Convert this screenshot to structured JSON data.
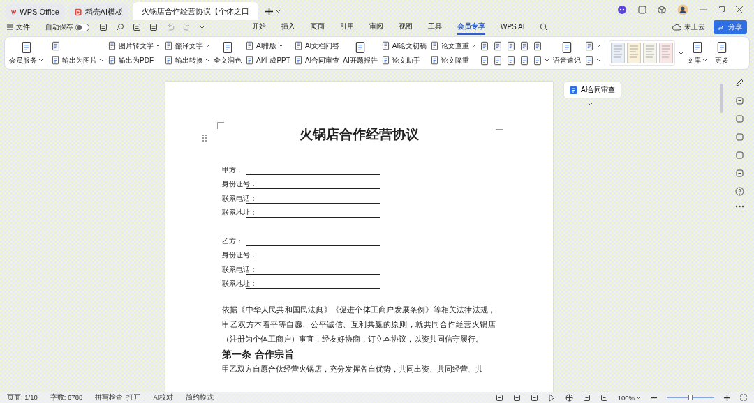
{
  "titlebar": {
    "tabs": [
      {
        "kind": "home",
        "label": "WPS Office",
        "selected": false
      },
      {
        "kind": "template",
        "label": "稻壳AI模板",
        "selected": false
      },
      {
        "kind": "doc",
        "label": "火锅店合作经营协议【个体之口",
        "selected": true
      }
    ]
  },
  "menubar": {
    "file": "文件",
    "autosave": {
      "label": "自动保存",
      "on": false
    },
    "tabs": [
      {
        "label": "开始",
        "selected": false
      },
      {
        "label": "插入",
        "selected": false
      },
      {
        "label": "页面",
        "selected": false
      },
      {
        "label": "引用",
        "selected": false
      },
      {
        "label": "审阅",
        "selected": false
      },
      {
        "label": "视图",
        "selected": false
      },
      {
        "label": "工具",
        "selected": false
      },
      {
        "label": "会员专享",
        "selected": true
      },
      {
        "label": "WPS AI",
        "selected": false
      }
    ],
    "cloud": "未上云",
    "share": "分享"
  },
  "ribbon": [
    {
      "kind": "big",
      "label": "会员服务",
      "caret": true
    },
    {
      "kind": "sep"
    },
    {
      "kind": "pair",
      "items": [
        {
          "kind": "icon",
          "caret": false
        },
        {
          "kind": "text",
          "label": "输出为图片",
          "caret": true
        }
      ]
    },
    {
      "kind": "pair",
      "items": [
        {
          "kind": "text",
          "label": "图片转文字",
          "caret": true
        },
        {
          "kind": "text",
          "label": "输出为PDF",
          "caret": false
        }
      ]
    },
    {
      "kind": "pair",
      "items": [
        {
          "kind": "text",
          "label": "翻译文字",
          "caret": true
        },
        {
          "kind": "text",
          "label": "输出转换",
          "caret": true
        }
      ]
    },
    {
      "kind": "big",
      "label": "全文润色",
      "caret": false
    },
    {
      "kind": "pair",
      "items": [
        {
          "kind": "text",
          "label": "AI排版",
          "caret": true
        },
        {
          "kind": "text",
          "label": "AI生成PPT",
          "caret": false
        }
      ]
    },
    {
      "kind": "pair",
      "items": [
        {
          "kind": "text",
          "label": "AI文档问答",
          "caret": false
        },
        {
          "kind": "text",
          "label": "AI合同审查",
          "caret": false
        }
      ]
    },
    {
      "kind": "big",
      "label": "AI开题报告",
      "caret": false
    },
    {
      "kind": "pair",
      "items": [
        {
          "kind": "text",
          "label": "AI论文初稿",
          "caret": false
        },
        {
          "kind": "text",
          "label": "论文助手",
          "caret": false
        }
      ]
    },
    {
      "kind": "pair",
      "items": [
        {
          "kind": "text",
          "label": "论文查重",
          "caret": true
        },
        {
          "kind": "text",
          "label": "论文降重",
          "caret": false
        }
      ]
    },
    {
      "kind": "pair",
      "items": [
        {
          "kind": "icon",
          "caret": false
        },
        {
          "kind": "icon",
          "caret": false
        }
      ]
    },
    {
      "kind": "pair",
      "items": [
        {
          "kind": "icon",
          "caret": false
        },
        {
          "kind": "icon",
          "caret": false
        }
      ]
    },
    {
      "kind": "pair",
      "items": [
        {
          "kind": "icon",
          "caret": false
        },
        {
          "kind": "icon",
          "caret": false
        }
      ]
    },
    {
      "kind": "pair",
      "items": [
        {
          "kind": "icon",
          "caret": false
        },
        {
          "kind": "icon",
          "caret": false
        }
      ]
    },
    {
      "kind": "pair",
      "items": [
        {
          "kind": "icon",
          "caret": false
        },
        {
          "kind": "icon",
          "caret": true
        }
      ]
    },
    {
      "kind": "big",
      "label": "语音速记",
      "caret": false
    },
    {
      "kind": "pair",
      "items": [
        {
          "kind": "icon",
          "caret": true
        },
        {
          "kind": "icon",
          "caret": true
        }
      ]
    },
    {
      "kind": "sep"
    },
    {
      "kind": "gallery"
    },
    {
      "kind": "big",
      "label": "文库",
      "caret": true
    },
    {
      "kind": "sep"
    },
    {
      "kind": "big",
      "label": "更多",
      "caret": false
    }
  ],
  "document": {
    "title": "火锅店合作经营协议",
    "parties": [
      {
        "fields": [
          {
            "label": "甲方：",
            "underline": true
          },
          {
            "label": "身份证号：",
            "underline": true
          },
          {
            "label": "联系电话：",
            "underline": true
          },
          {
            "label": "联系地址：",
            "underline": true
          }
        ]
      },
      {
        "fields": [
          {
            "label": "乙方：",
            "underline": true
          },
          {
            "label": "身份证号：",
            "underline": false
          },
          {
            "label": "联系电话：",
            "underline": true
          },
          {
            "label": "联系地址：",
            "underline": true
          }
        ]
      }
    ],
    "paragraphs": [
      {
        "kind": "body",
        "text": "依据《中华人民共和国民法典》《促进个体工商户发展条例》等相关法律法规，甲乙双方本着平等自愿、公平诚信、互利共赢的原则，就共同合作经营火锅店（注册为个体工商户）事宜，经友好协商，订立本协议，以资共同信守履行。"
      },
      {
        "kind": "heading",
        "text": "第一条  合作宗旨"
      },
      {
        "kind": "body",
        "text": "甲乙双方自愿合伙经营火锅店，充分发挥各自优势，共同出资、共同经营、共"
      }
    ]
  },
  "side_panel": {
    "label": "AI合同审查"
  },
  "statusbar": {
    "items": [
      "页面: 1/10",
      "字数: 6788",
      "拼写检查: 打开",
      "AI校对",
      "简约模式"
    ],
    "zoom": "100%",
    "zoom_slider": {
      "level": 0.5
    }
  }
}
